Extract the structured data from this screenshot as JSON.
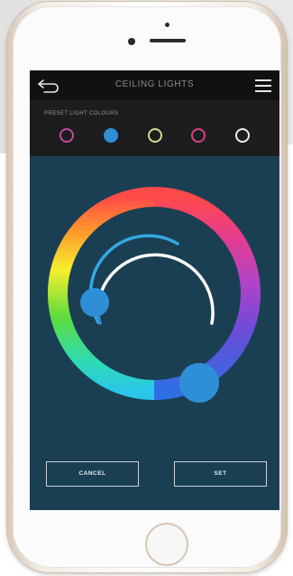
{
  "app": {
    "title": "CEILING LIGHTS",
    "preset_label": "PRESET LIGHT COLOURS",
    "back_icon": "back-arrow-icon",
    "menu_icon": "hamburger-menu-icon"
  },
  "presets": [
    {
      "name": "magenta",
      "color": "#c14b9a",
      "selected": false
    },
    {
      "name": "blue",
      "color": "#2e8fd6",
      "selected": true
    },
    {
      "name": "yellow",
      "color": "#d9d98c",
      "selected": false
    },
    {
      "name": "pink",
      "color": "#d9417a",
      "selected": false
    },
    {
      "name": "white",
      "color": "#eeeeee",
      "selected": false
    }
  ],
  "colors": {
    "screen_bg": "#1a3f53",
    "topbar_bg": "#111111",
    "preset_bg": "#1d1d1f",
    "knob": "#2e8fd6",
    "inner_arc": "#ffffff"
  },
  "buttons": {
    "cancel": "CANCEL",
    "set": "SET"
  }
}
